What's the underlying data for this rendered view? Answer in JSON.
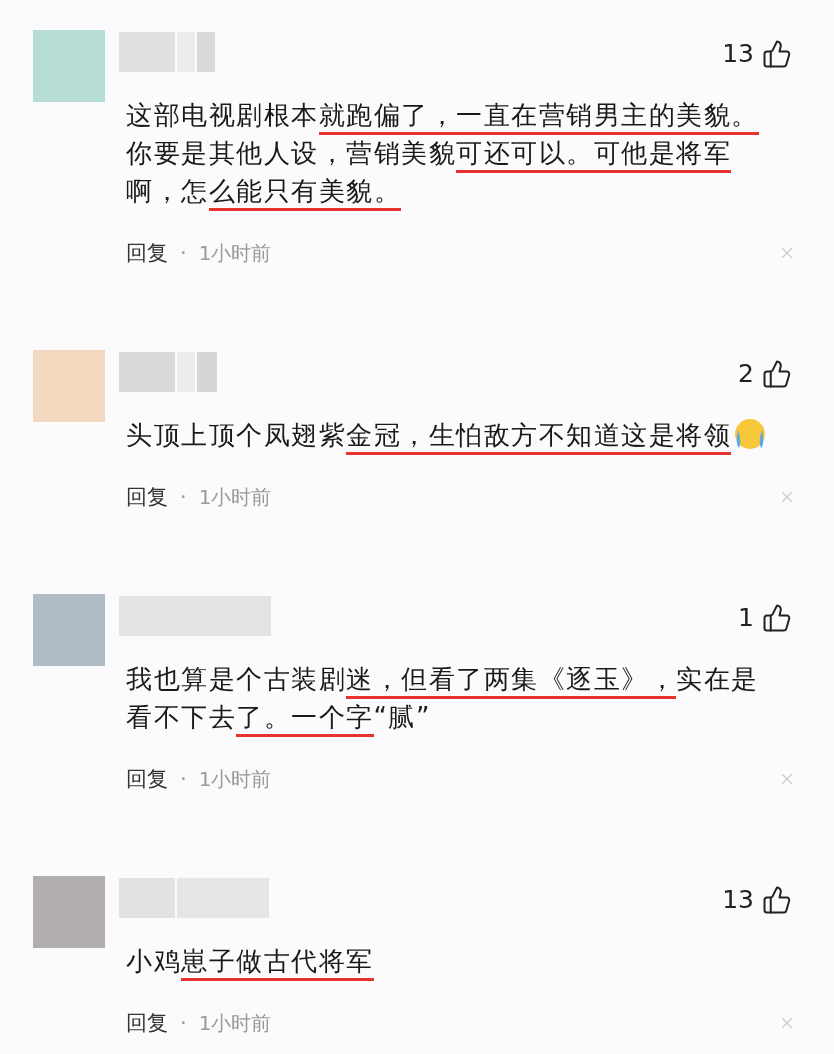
{
  "comments": [
    {
      "color": "#b5ddd3",
      "likes": "13",
      "segments": [
        {
          "text": "这部电视剧根本",
          "underlined": false
        },
        {
          "text": "就跑偏了，一直在营销男主的美貌。",
          "underlined": true
        },
        {
          "text": "你要是其他人设，营销美貌",
          "underlined": false
        },
        {
          "text": "可还可以。可他是将军",
          "underlined": true
        },
        {
          "text": "啊，怎",
          "underlined": false
        },
        {
          "text": "么能只有美貌。",
          "underlined": true
        }
      ],
      "reply": "回复",
      "separator": "·",
      "time": "1小时前"
    },
    {
      "color": "#f2d9bf",
      "likes": "2",
      "segments": [
        {
          "text": "头顶上顶个凤翅紫",
          "underlined": false
        },
        {
          "text": "金冠，生怕敌方不知道这是将领",
          "underlined": true
        }
      ],
      "emoji": true,
      "reply": "回复",
      "separator": "·",
      "time": "1小时前"
    },
    {
      "color": "#b0bcc6",
      "likes": "1",
      "segments": [
        {
          "text": "我也算是个古装剧",
          "underlined": false
        },
        {
          "text": "迷，但看了两集《逐玉》，",
          "underlined": true
        },
        {
          "text": "实在是看不下去",
          "underlined": false
        },
        {
          "text": "了。一个字",
          "underlined": true
        },
        {
          "text": "“腻”",
          "underlined": false
        }
      ],
      "reply": "回复",
      "separator": "·",
      "time": "1小时前"
    },
    {
      "color": "#b3aeae",
      "likes": "13",
      "segments": [
        {
          "text": "小鸡",
          "underlined": false
        },
        {
          "text": "崽子做古代将军",
          "underlined": true
        }
      ],
      "reply": "回复",
      "separator": "·",
      "time": "1小时前"
    }
  ]
}
